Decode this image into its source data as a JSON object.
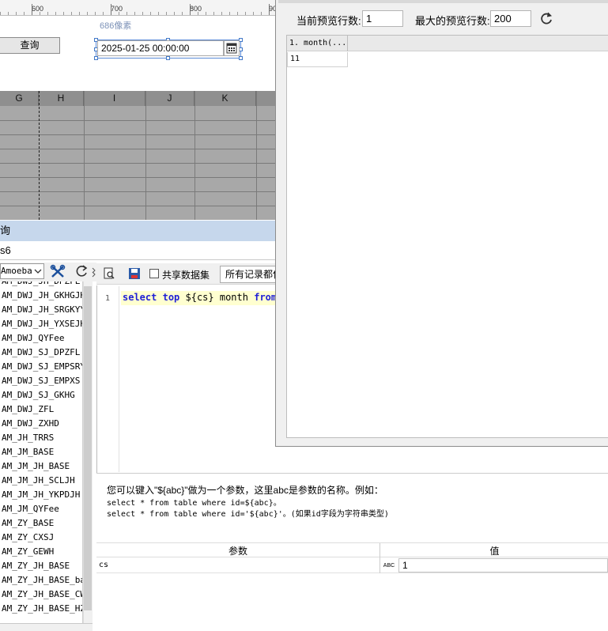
{
  "ruler": {
    "labels": [
      "600",
      "700",
      "800",
      "90"
    ]
  },
  "designer": {
    "query_button": "查询",
    "size_hint": "686像素",
    "date_value": "2025-01-25 00:00:00"
  },
  "grid": {
    "columns": [
      "G",
      "H",
      "I",
      "J",
      "K"
    ]
  },
  "query_panel": {
    "title": "询",
    "dataset_name": "s6",
    "connection": "Amoeba",
    "share_label": "共享数据集",
    "all_records": "所有记录都使",
    "line_number": "1",
    "tables": [
      "AM_DWJ_JH_DPZFL",
      "AM_DWJ_JH_GKHGJH",
      "AM_DWJ_JH_SRGKYYJJ",
      "AM_DWJ_JH_YXSEJH",
      "AM_DWJ_QYFee",
      "AM_DWJ_SJ_DPZFL",
      "AM_DWJ_SJ_EMPSRYY",
      "AM_DWJ_SJ_EMPXS",
      "AM_DWJ_SJ_GKHG",
      "AM_DWJ_ZFL",
      "AM_DWJ_ZXHD",
      "AM_JH_TRRS",
      "AM_JM_BASE",
      "AM_JM_JH_BASE",
      "AM_JM_JH_SCLJH",
      "AM_JM_JH_YKPDJH",
      "AM_JM_QYFee",
      "AM_ZY_BASE",
      "AM_ZY_CXSJ",
      "AM_ZY_GEWH",
      "AM_ZY_JH_BASE",
      "AM_ZY_JH_BASE_bak",
      "AM_ZY_JH_BASE_CW",
      "AM_ZY_JH_BASE_HZXM"
    ],
    "hint_line1": "您可以键入\"${abc}\"做为一个参数，这里abc是参数的名称。例如：",
    "hint_line2": "select * from table where id=${abc}。",
    "hint_line3": "select * from table where id='${abc}'。(如果id字段为字符串类型)",
    "param_header": "参数",
    "value_header": "值",
    "param_name": "cs",
    "param_type": "ABC",
    "param_value": "1"
  },
  "code": {
    "kw1": "select",
    "kw2": "top",
    "var": " ${cs} ",
    "col": "month ",
    "kw3": "from"
  },
  "preview": {
    "current_rows_label": "当前预览行数:",
    "current_rows": "1",
    "max_rows_label": "最大的预览行数:",
    "max_rows": "200",
    "column_header": "1. month(...",
    "cell_value": "11"
  }
}
